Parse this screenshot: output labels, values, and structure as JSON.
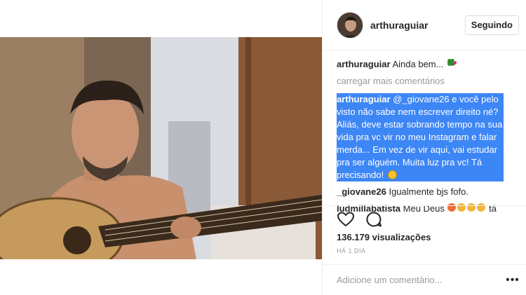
{
  "header": {
    "username": "arthuraguiar",
    "follow_label": "Seguindo"
  },
  "caption": {
    "user": "arthuraguiar",
    "text": "Ainda bem..."
  },
  "load_more_label": "carregar mais comentários",
  "comments": [
    {
      "user": "arthuraguiar",
      "mention": "@_giovane26",
      "text": "e você pelo visto não sabe nem escrever direito né? Aliás, deve estar sobrando tempo na sua vida pra vc vir no meu Instagram e falar merda... Em vez de vir aqui, vai estudar pra ser alguém. Muita luz pra vc! Tá precisando!",
      "selected": true
    },
    {
      "user": "_giovane26",
      "text": "Igualmente bjs fofo."
    },
    {
      "user": "ludmillabatista",
      "text": "Meu Deus",
      "trailing": "tá"
    }
  ],
  "stats": {
    "views": "136.179 visualizações",
    "time": "HÁ 1 DIA"
  },
  "add_comment": {
    "placeholder": "Adicione um comentário..."
  },
  "icons": {
    "like": "heart-icon",
    "comment": "comment-icon",
    "more": "more-options-icon"
  },
  "colors": {
    "selection": "#3d86f5",
    "muted": "#999999",
    "text": "#262626",
    "border": "#efefef"
  }
}
